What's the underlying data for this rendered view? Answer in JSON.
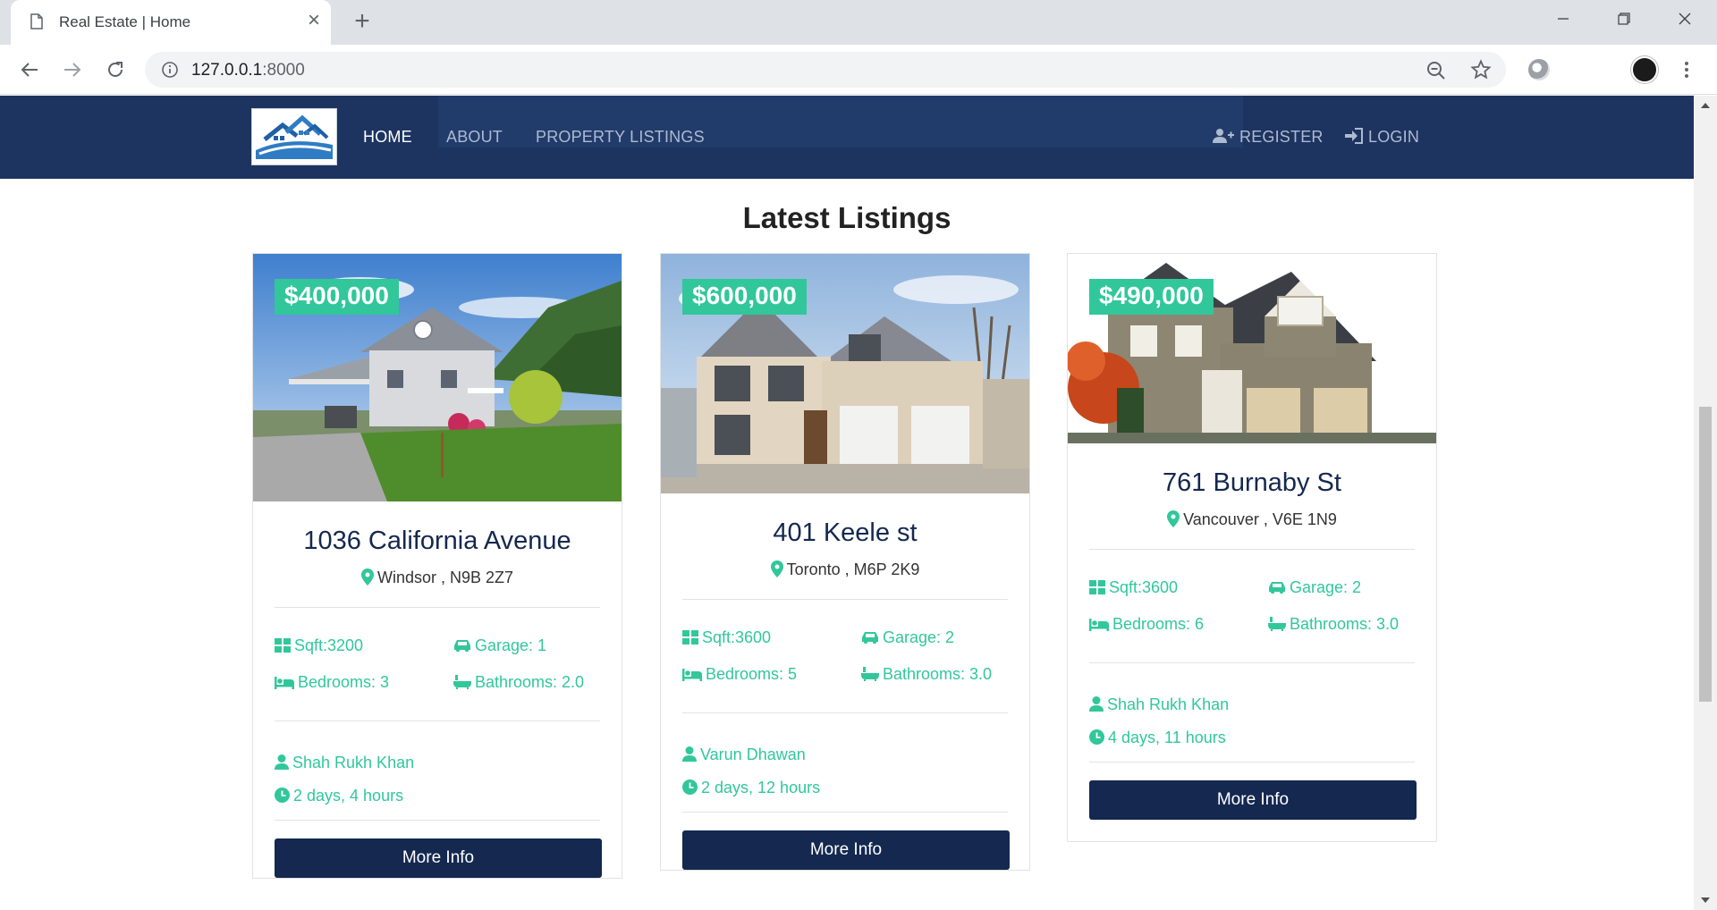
{
  "browser": {
    "tab_title": "Real Estate | Home",
    "url_host": "127.0.0.1",
    "url_port": ":8000"
  },
  "nav": {
    "links": [
      "HOME",
      "ABOUT",
      "PROPERTY LISTINGS"
    ],
    "register": "REGISTER",
    "login": "LOGIN"
  },
  "section_title": "Latest Listings",
  "colors": {
    "accent": "#31c79b",
    "navy": "#142850",
    "navbar": "#1d3461"
  },
  "listings": [
    {
      "price": "$400,000",
      "title": "1036 California Avenue",
      "location": "Windsor , N9B 2Z7",
      "sqft": "Sqft:3200",
      "garage": "Garage: 1",
      "bedrooms": "Bedrooms: 3",
      "bathrooms": "Bathrooms: 2.0",
      "realtor": "Shah Rukh Khan",
      "listed": "2 days, 4 hours",
      "button": "More Info"
    },
    {
      "price": "$600,000",
      "title": "401 Keele st",
      "location": "Toronto , M6P 2K9",
      "sqft": "Sqft:3600",
      "garage": "Garage: 2",
      "bedrooms": "Bedrooms: 5",
      "bathrooms": "Bathrooms: 3.0",
      "realtor": "Varun Dhawan",
      "listed": "2 days, 12 hours",
      "button": "More Info"
    },
    {
      "price": "$490,000",
      "title": "761 Burnaby St",
      "location": "Vancouver , V6E 1N9",
      "sqft": "Sqft:3600",
      "garage": "Garage: 2",
      "bedrooms": "Bedrooms: 6",
      "bathrooms": "Bathrooms: 3.0",
      "realtor": "Shah Rukh Khan",
      "listed": "4 days, 11 hours",
      "button": "More Info"
    }
  ]
}
